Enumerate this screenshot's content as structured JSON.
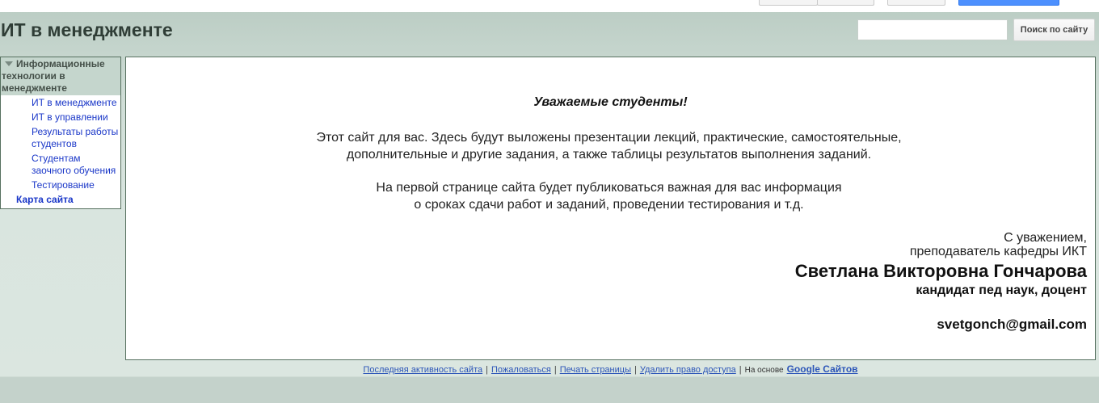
{
  "header": {
    "site_title": "ИТ в менеджменте",
    "search_placeholder": "",
    "search_button_label": "Поиск по сайту"
  },
  "sidebar": {
    "section_title": "Информационные технологии в менеджменте",
    "items": [
      {
        "label": "ИТ в менеджменте"
      },
      {
        "label": "ИТ в управлении"
      },
      {
        "label": "Результаты работы студентов"
      },
      {
        "label": "Студентам заочного обучения"
      },
      {
        "label": "Тестирование"
      }
    ],
    "sitemap_label": "Карта сайта"
  },
  "main": {
    "greeting": "Уважаемые студенты!",
    "paragraph1_line1": "Этот сайт для вас. Здесь будут выложены  презентации лекций, практические, самостоятельные,",
    "paragraph1_line2": "дополнительные и другие задания, а также таблицы результатов выполнения заданий.",
    "paragraph2_line1": "На первой странице сайта  будет публиковаться важная для вас информация",
    "paragraph2_line2": "о сроках сдачи работ и заданий, проведении тестирования и т.д.",
    "signature": {
      "regards": "С уважением,",
      "position": "преподаватель кафедры ИКТ",
      "name": "Светлана Викторовна Гончарова",
      "degree": "кандидат пед наук, доцент",
      "email": "svetgonch@gmail.com"
    }
  },
  "footer": {
    "links": [
      {
        "label": "Последняя активность сайта"
      },
      {
        "label": "Пожаловаться"
      },
      {
        "label": "Печать страницы"
      },
      {
        "label": "Удалить право доступа"
      }
    ],
    "based_on": "На основе",
    "google_sites": "Google Сайтов"
  },
  "colors": {
    "link": "#1a37c8",
    "header_bg": "#b9cbc2",
    "sidebar_head_bg": "#c5d6cd",
    "border": "#56705f"
  }
}
